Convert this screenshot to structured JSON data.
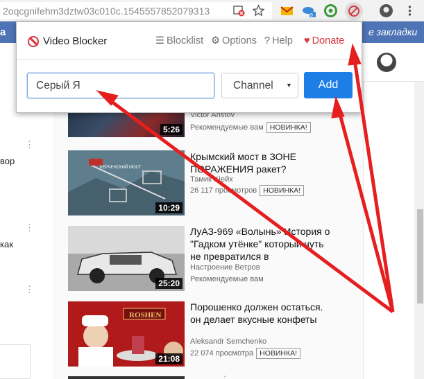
{
  "browser": {
    "url": "2oqcgnifehm3dztw03c010c.1545557852079313",
    "bookmarks_left": "a",
    "bookmarks_right": "е закладки"
  },
  "popup": {
    "brand": "Video Blocker",
    "nav": [
      {
        "icon": "list-icon",
        "label": "Blocklist"
      },
      {
        "icon": "gear-icon",
        "label": "Options"
      },
      {
        "icon": "help-icon",
        "label": "Help"
      },
      {
        "icon": "heart-icon",
        "label": "Donate"
      }
    ],
    "input_value": "Серый Я",
    "type_selected": "Channel",
    "add_label": "Add",
    "accent_color": "#1d7ee8"
  },
  "left_fragments": [
    "вор",
    "как"
  ],
  "videos": [
    {
      "title": "",
      "channel": "Victor Aristov",
      "meta": "Рекомендуемые вам",
      "badge": "НОВИНКА!",
      "duration": "5:26"
    },
    {
      "title": "Крымский мост в ЗОНЕ ПОРАЖЕНИЯ ракет?",
      "channel": "Тамик Шейх",
      "meta": "26 117 просмотров",
      "badge": "НОВИНКА!",
      "duration": "10:29",
      "thumb_text": "КЕРЧЕНСКИЙ МОСТ"
    },
    {
      "title": "ЛуАЗ-969 «Волынь» История о \"Гадком утёнке\" который чуть не превратился в",
      "channel": "Настроение Ветров",
      "meta": "Рекомендуемые вам",
      "badge": "",
      "duration": "25:20"
    },
    {
      "title": "Порошенко должен остаться. он делает вкусные конфеты",
      "channel": "Aleksandr Semchenko",
      "meta": "22 074 просмотра",
      "badge": "НОВИНКА!",
      "duration": "21:08",
      "thumb_text": "ROSHEN"
    }
  ]
}
